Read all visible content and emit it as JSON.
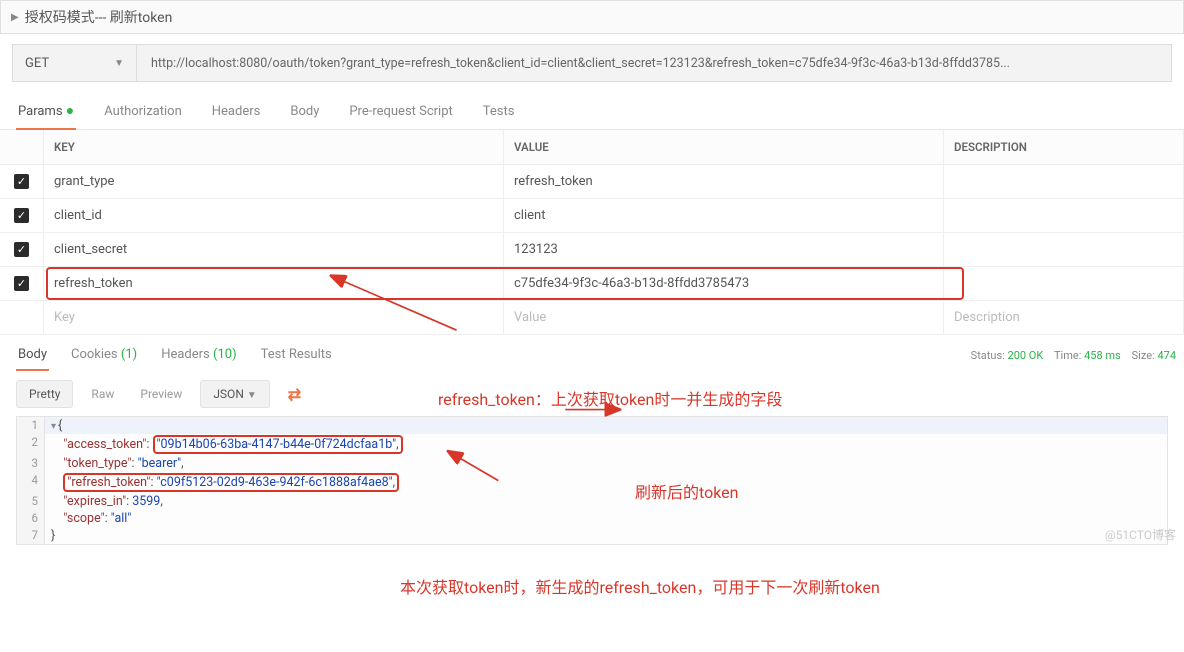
{
  "titleBar": {
    "label": "授权码模式--- 刷新token"
  },
  "request": {
    "method": "GET",
    "url": "http://localhost:8080/oauth/token?grant_type=refresh_token&client_id=client&client_secret=123123&refresh_token=c75dfe34-9f3c-46a3-b13d-8ffdd3785..."
  },
  "reqTabs": {
    "params": "Params",
    "auth": "Authorization",
    "headers": "Headers",
    "body": "Body",
    "prereq": "Pre-request Script",
    "tests": "Tests"
  },
  "columns": {
    "key": "KEY",
    "value": "VALUE",
    "desc": "DESCRIPTION"
  },
  "params": [
    {
      "key": "grant_type",
      "value": "refresh_token",
      "desc": "",
      "checked": true,
      "highlight": false
    },
    {
      "key": "client_id",
      "value": "client",
      "desc": "",
      "checked": true,
      "highlight": false
    },
    {
      "key": "client_secret",
      "value": "123123",
      "desc": "",
      "checked": true,
      "highlight": false
    },
    {
      "key": "refresh_token",
      "value": "c75dfe34-9f3c-46a3-b13d-8ffdd3785473",
      "desc": "",
      "checked": true,
      "highlight": true
    }
  ],
  "placeholderRow": {
    "key": "Key",
    "value": "Value",
    "desc": "Description"
  },
  "resTabs": {
    "body": "Body",
    "cookies": "Cookies",
    "cookiesCount": "(1)",
    "headers": "Headers",
    "headersCount": "(10)",
    "testResults": "Test Results"
  },
  "status": {
    "statusLabel": "Status:",
    "statusValue": "200 OK",
    "timeLabel": "Time:",
    "timeValue": "458 ms",
    "sizeLabel": "Size:",
    "sizeValue": "474"
  },
  "viewer": {
    "pretty": "Pretty",
    "raw": "Raw",
    "preview": "Preview",
    "format": "JSON"
  },
  "response": {
    "access_token": "09b14b06-63ba-4147-b44e-0f724dcfaa1b",
    "token_type": "bearer",
    "refresh_token": "c09f5123-02d9-463e-942f-6c1888af4ae8",
    "expires_in": 3599,
    "scope": "all"
  },
  "annotations": {
    "a1": "refresh_token：上次获取token时一并生成的字段",
    "a2": "刷新后的token",
    "a3": "本次获取token时，新生成的refresh_token，可用于下一次刷新token"
  },
  "watermark": "@51CTO博客"
}
